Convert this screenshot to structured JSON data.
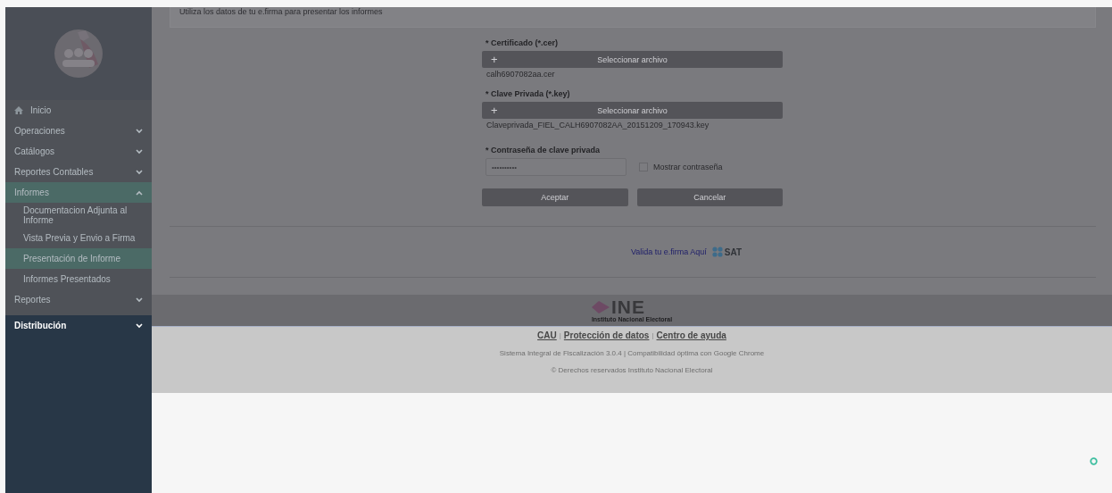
{
  "sidebar": {
    "menu": [
      {
        "label": "Inicio",
        "kind": "link",
        "selected": false
      },
      {
        "label": "Operaciones",
        "kind": "group",
        "expanded": false,
        "selected": false
      },
      {
        "label": "Catálogos",
        "kind": "group",
        "expanded": false,
        "selected": false
      },
      {
        "label": "Reportes Contables",
        "kind": "group",
        "expanded": false,
        "selected": false
      },
      {
        "label": "Informes",
        "kind": "group",
        "expanded": true,
        "selected": true,
        "children": [
          {
            "label": "Documentacion Adjunta al Informe",
            "selected": false
          },
          {
            "label": "Vista Previa y Envio a Firma",
            "selected": false
          },
          {
            "label": "Presentación de Informe",
            "selected": true
          },
          {
            "label": "Informes Presentados",
            "selected": false
          }
        ]
      },
      {
        "label": "Reportes",
        "kind": "group",
        "expanded": false,
        "selected": false
      }
    ],
    "footer_item": {
      "label": "Distribución",
      "expanded": false
    }
  },
  "notice": "Utiliza los datos de tu e.firma para presentar los informes",
  "form": {
    "certificate": {
      "label": "* Certificado (*.cer)",
      "button": "Seleccionar archivo",
      "button_icon": "+",
      "file": "calh6907082aa.cer"
    },
    "private_key": {
      "label": "* Clave Privada (*.key)",
      "button": "Seleccionar archivo",
      "button_icon": "+",
      "file": "Claveprivada_FIEL_CALH6907082AA_20151209_170943.key"
    },
    "password": {
      "label": "* Contraseña de clave privada",
      "value": "••••••••••",
      "show_label": "Mostrar contraseña",
      "show_checked": false
    },
    "buttons": [
      "Aceptar",
      "Cancelar"
    ]
  },
  "validate": {
    "link": "Valida tu e.firma Aquí",
    "logo": "SAT"
  },
  "footer": {
    "logo": {
      "name": "INE",
      "subtitle": "Instituto Nacional Electoral"
    },
    "links": [
      "CAU",
      "Protección de datos",
      "Centro de ayuda"
    ],
    "separator": "|",
    "version": "Sistema Integral de Fiscalización 3.0.4 | Compatibilidad óptima con Google Chrome",
    "copyright": "© Derechos reservados Instituto Nacional Electoral"
  }
}
